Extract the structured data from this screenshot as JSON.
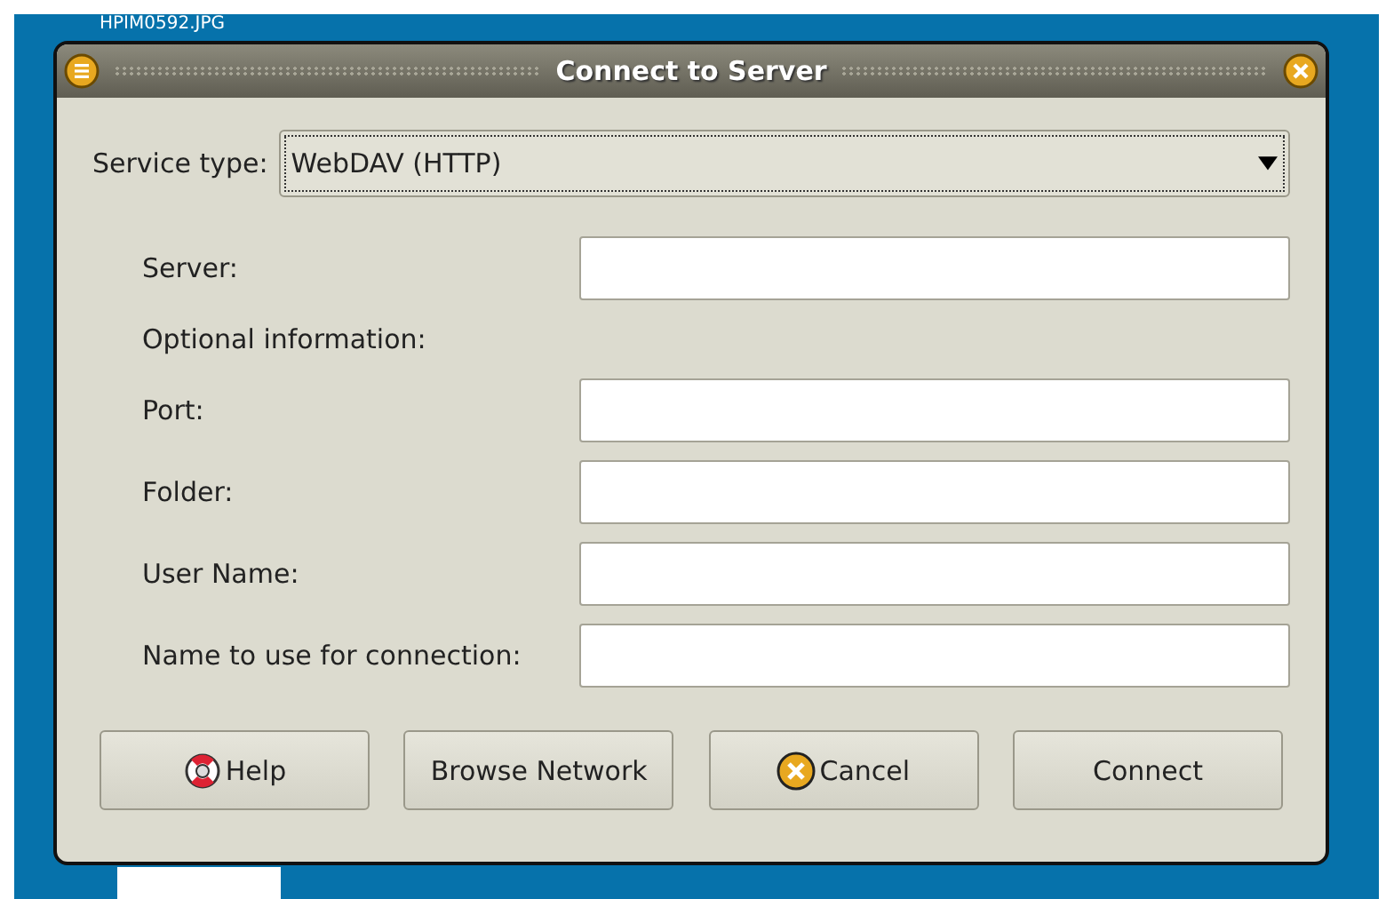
{
  "desktop": {
    "icon_label": "HPIM0592.JPG"
  },
  "window": {
    "title": "Connect to Server"
  },
  "service_type": {
    "label": "Service type:",
    "value": "WebDAV (HTTP)"
  },
  "fields": [
    {
      "kind": "field",
      "label": "Server:"
    },
    {
      "kind": "heading",
      "label": "Optional information:"
    },
    {
      "kind": "field",
      "label": "Port:"
    },
    {
      "kind": "field",
      "label": "Folder:"
    },
    {
      "kind": "field",
      "label": "User Name:"
    },
    {
      "kind": "field",
      "label": "Name to use for connection:"
    }
  ],
  "buttons": [
    {
      "kind": "help",
      "label": "Help"
    },
    {
      "kind": "plain",
      "label": "Browse Network"
    },
    {
      "kind": "cancel",
      "label": "Cancel"
    },
    {
      "kind": "plain",
      "label": "Connect"
    }
  ]
}
